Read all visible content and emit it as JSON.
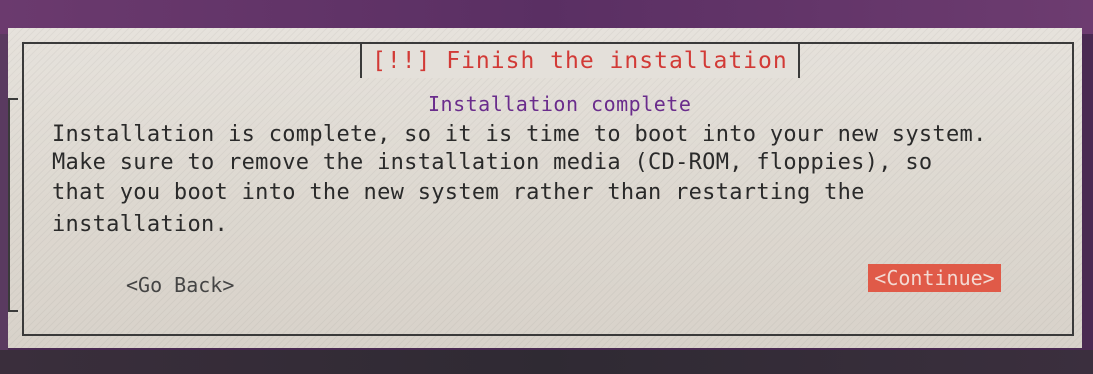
{
  "dialog": {
    "title": "[!!] Finish the installation",
    "heading": "Installation complete",
    "body_lines": [
      "Installation is complete, so it is time to boot into your new system.",
      "Make sure to remove the installation media (CD-ROM, floppies), so",
      "that you boot into the new system rather than restarting the",
      "installation."
    ],
    "buttons": {
      "go_back": "<Go Back>",
      "continue": "<Continue>"
    }
  },
  "colors": {
    "title": "#d23a36",
    "heading": "#6a2c8c",
    "selected_button_bg": "#e05a48",
    "dialog_bg": "#e0dbd4",
    "desktop_bg": "#5a2f63"
  }
}
